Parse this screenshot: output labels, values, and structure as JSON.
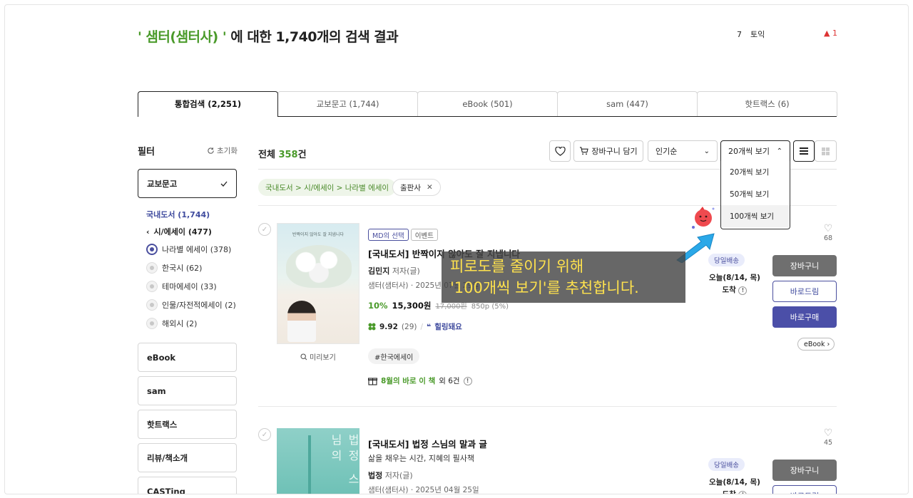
{
  "search": {
    "keyword": "' 샘터(샘터사) '",
    "suffix": " 에 대한 1,740개의 검색 결과"
  },
  "rank": {
    "num": "7",
    "word": "토익",
    "delta": "▲ 1"
  },
  "tabs": [
    "통합검색 (2,251)",
    "교보문고 (1,744)",
    "eBook (501)",
    "sam (447)",
    "핫트랙스 (6)"
  ],
  "filter": {
    "title": "필터",
    "reset": "초기화",
    "store": "교보문고",
    "category_l1": "국내도서 (1,744)",
    "category_l2": "시/에세이 (477)",
    "options": [
      {
        "label": "나라별 에세이 (378)",
        "selected": true
      },
      {
        "label": "한국시 (62)",
        "selected": false
      },
      {
        "label": "테마에세이 (33)",
        "selected": false
      },
      {
        "label": "인물/자전적에세이 (2)",
        "selected": false
      },
      {
        "label": "해외시 (2)",
        "selected": false
      }
    ],
    "other_stores": [
      "eBook",
      "sam",
      "핫트랙스",
      "리뷰/책소개",
      "CASTing"
    ]
  },
  "results": {
    "total_label": "전체",
    "total_count": "358",
    "total_unit": "건",
    "cart_all": "장바구니 담기",
    "sort": "인기순",
    "per_page": "20개씩 보기",
    "per_page_options": [
      "20개씩 보기",
      "50개씩 보기",
      "100개씩 보기"
    ],
    "breadcrumb_chip": "국내도서 > 시/에세이 > 나라별 에세이",
    "publisher_chip": "출판사"
  },
  "books": [
    {
      "badges": [
        "MD의 선택",
        "이벤트"
      ],
      "title": "[국내도서] 반짝이지 않아도 잘 지냅니다",
      "author": "김민지",
      "author_role": "저자(글)",
      "publisher_date": "샘터(샘터사) · 2025년 07월 29일",
      "discount": "10%",
      "price": "15,300원",
      "orig_price": "17,000원",
      "points": "850p (5%)",
      "score": "9.92",
      "reviews": "(29)",
      "review_kw": "힐링돼요",
      "tag": "#한국에세이",
      "event": "8월의 바로 이 책",
      "event_more": "외 6건",
      "shipping": "당일배송",
      "arrive": "오늘(8/14, 목)",
      "arrive2": "도착",
      "likes": "68",
      "preview": "미리보기",
      "cover_title": "반짝이지 않아도 잘 지냅니다"
    },
    {
      "title": "[국내도서] 법정 스님의 말과 글",
      "subtitle": "삶을 채우는 시간, 지혜의 필사책",
      "author": "법정",
      "author_role": "저자(글)",
      "publisher_date": "샘터(샘터사) · 2025년 04월 25일",
      "shipping": "당일배송",
      "arrive": "오늘(8/14, 목)",
      "arrive2": "도착",
      "likes": "45",
      "cover_title": "법정 스님의"
    }
  ],
  "actions": {
    "cart": "장바구니",
    "gift": "바로드림",
    "buy": "바로구매",
    "ebook": "eBook"
  },
  "overlay": {
    "line1": "피로도를 줄이기 위해",
    "line2": "'100개씩 보기'를 추천합니다."
  },
  "colors": {
    "accent_green": "#4a9a2a",
    "accent_navy": "#4a4f9e",
    "overlay_text": "#ffe24d"
  }
}
